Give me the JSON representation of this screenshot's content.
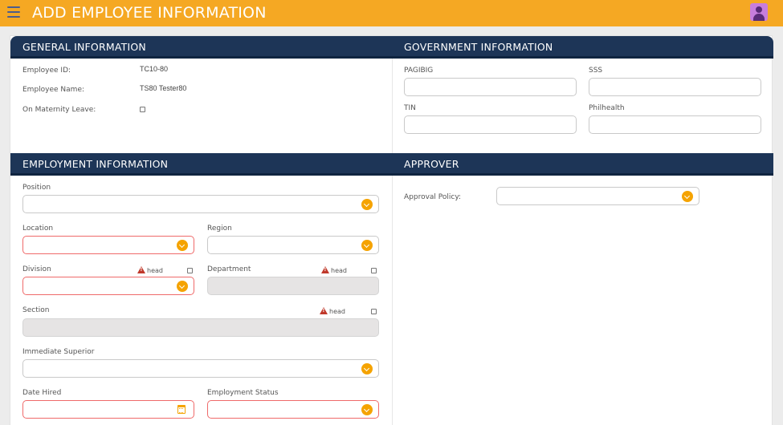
{
  "header": {
    "title": "ADD EMPLOYEE INFORMATION",
    "menu_icon": "hamburger-menu-icon",
    "avatar_icon": "user-avatar-icon",
    "background": "#f5a823"
  },
  "general": {
    "title": "GENERAL INFORMATION",
    "employee_id_label": "Employee ID:",
    "employee_id_value": "TC10-80",
    "employee_name_label": "Employee Name:",
    "employee_name_value": "TS80  Tester80",
    "maternity_label": "On Maternity Leave:",
    "maternity_checked": false
  },
  "government": {
    "title": "GOVERNMENT INFORMATION",
    "pagibig_label": "PAGIBIG",
    "pagibig_value": "",
    "sss_label": "SSS",
    "sss_value": "",
    "tin_label": "TIN",
    "tin_value": "",
    "philhealth_label": "Philhealth",
    "philhealth_value": ""
  },
  "employment": {
    "title": "EMPLOYMENT INFORMATION",
    "position_label": "Position",
    "location_label": "Location",
    "region_label": "Region",
    "division_label": "Division",
    "department_label": "Department",
    "section_label": "Section",
    "head_label": "head",
    "immediate_superior_label": "Immediate Superior",
    "date_hired_label": "Date Hired",
    "employment_status_label": "Employment Status"
  },
  "approver": {
    "title": "APPROVER",
    "approval_policy_label": "Approval Policy:"
  },
  "colors": {
    "header_bar": "#f5a823",
    "section_header": "#1d3557",
    "dropdown_accent": "#f5a300",
    "required_border": "#ef6a6a",
    "warning": "#c0392b"
  }
}
